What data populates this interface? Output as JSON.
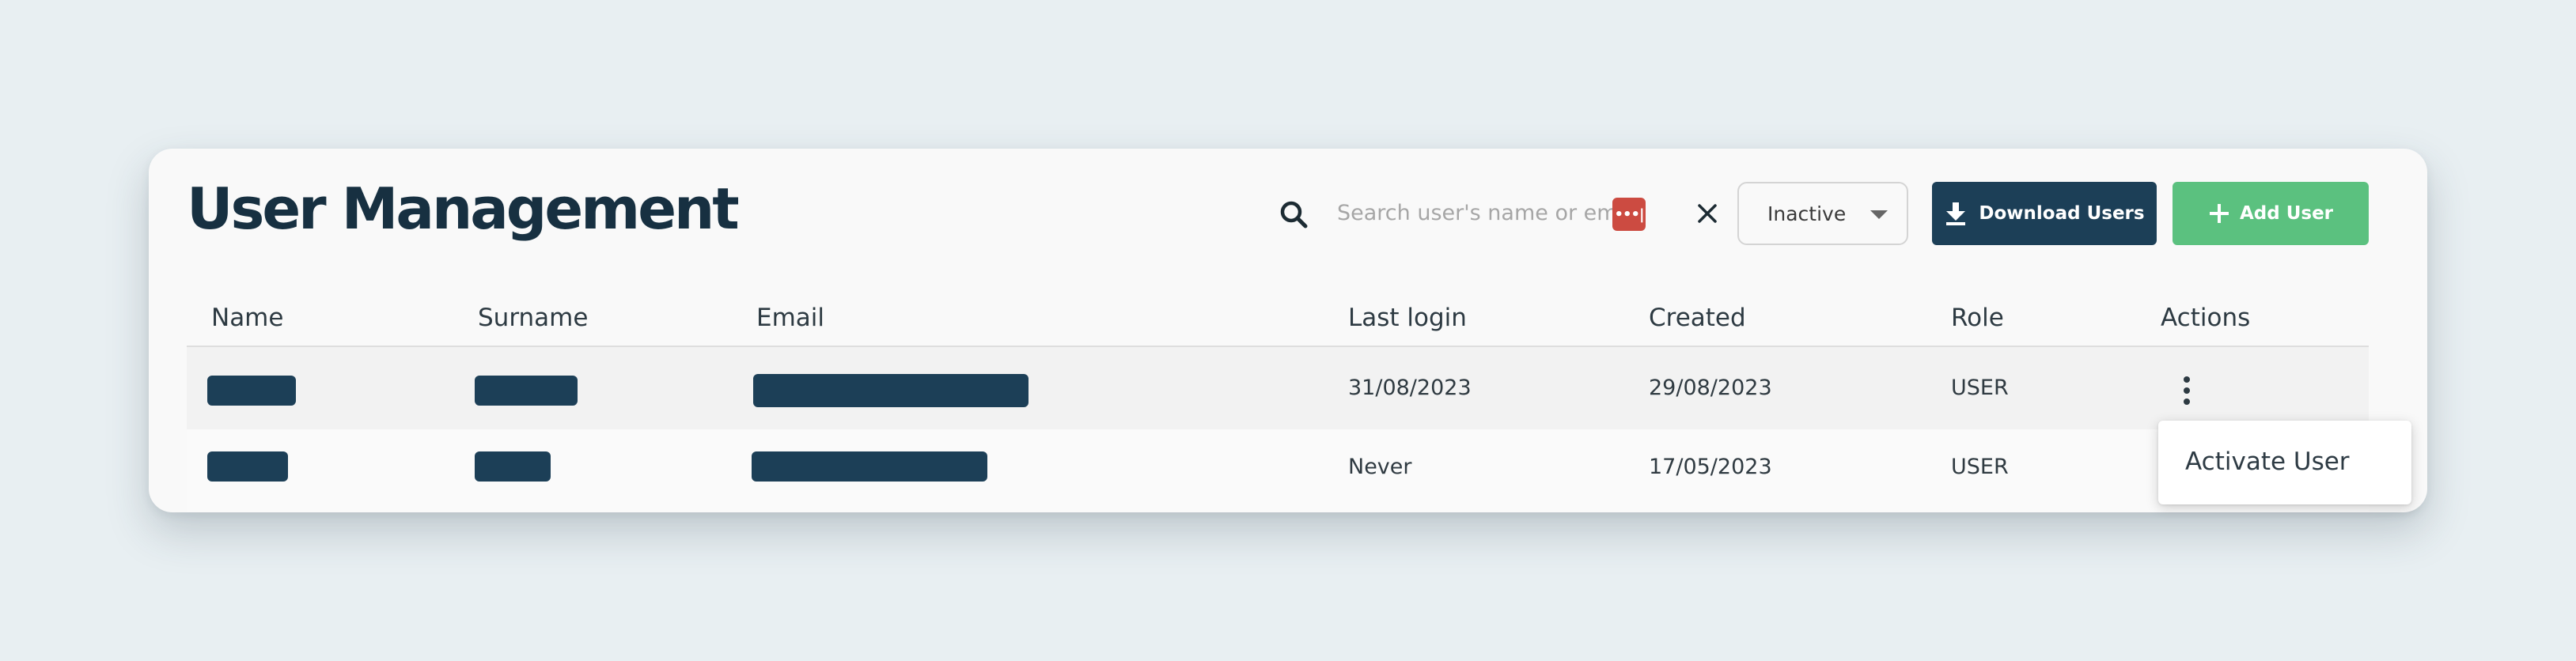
{
  "page": {
    "title": "User Management"
  },
  "toolbar": {
    "search_placeholder": "Search user's name or ema",
    "password_badge": "•••|",
    "status_value": "Inactive",
    "download_label": "Download Users",
    "add_label": "Add User"
  },
  "table": {
    "columns": [
      "Name",
      "Surname",
      "Email",
      "Last login",
      "Created",
      "Role",
      "Actions"
    ],
    "rows": [
      {
        "last_login": "31/08/2023",
        "created": "29/08/2023",
        "role": "USER"
      },
      {
        "last_login": "Never",
        "created": "17/05/2023",
        "role": "USER"
      }
    ]
  },
  "actions_menu": {
    "items": [
      "Activate User"
    ]
  },
  "colors": {
    "primary": "#1c3f57",
    "success": "#5bc17f",
    "background": "#e8eff2"
  },
  "icons": [
    "search-icon",
    "close-icon",
    "chevron-down-icon",
    "download-icon",
    "plus-icon",
    "more-vertical-icon"
  ]
}
